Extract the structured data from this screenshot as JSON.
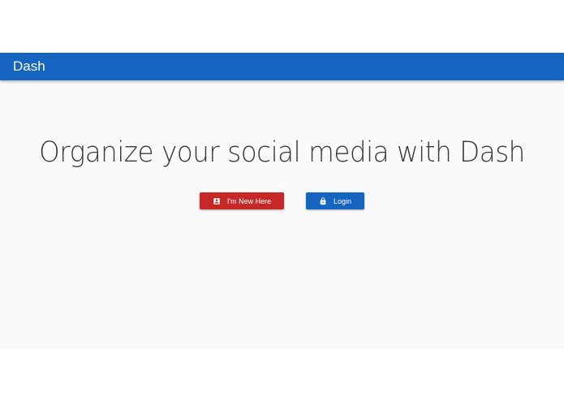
{
  "appbar": {
    "title": "Dash",
    "color": "#1565c0"
  },
  "hero": {
    "headline": "Organize your social media with Dash"
  },
  "actions": {
    "new_here": {
      "label": "I'm New Here",
      "icon": "account-box-icon",
      "color": "#c62828"
    },
    "login": {
      "label": "Login",
      "icon": "lock-icon",
      "color": "#1565c0"
    }
  },
  "colors": {
    "background": "#fafafa",
    "headline_text": "#3a3a3a"
  }
}
